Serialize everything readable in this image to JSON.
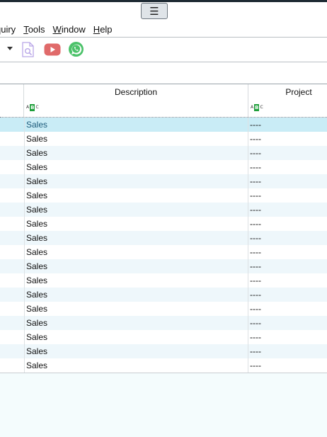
{
  "titlebar": {
    "menu_button_glyph": "☰"
  },
  "menubar": {
    "items": [
      {
        "label": "quiry"
      },
      {
        "label": "Tools",
        "accel": "T",
        "rest": "ools"
      },
      {
        "label": "Window",
        "accel": "W",
        "rest": "indow"
      },
      {
        "label": "Help",
        "accel": "H",
        "rest": "elp"
      }
    ]
  },
  "toolbar": {
    "icons": [
      "dropdown-arrow-icon",
      "document-search-icon",
      "youtube-icon",
      "whatsapp-icon"
    ],
    "colors": {
      "youtube": "#e06a6a",
      "whatsapp": "#4cc26a",
      "doc": "#b9a6e8"
    }
  },
  "grid": {
    "columns": [
      {
        "title": "Description",
        "type_badge": [
          "A",
          "B",
          "C"
        ]
      },
      {
        "title": "Project",
        "type_badge": [
          "A",
          "B",
          "C"
        ]
      }
    ],
    "rows": [
      {
        "description": "Sales",
        "project": "----"
      },
      {
        "description": "Sales",
        "project": "----"
      },
      {
        "description": "Sales",
        "project": "----"
      },
      {
        "description": "Sales",
        "project": "----"
      },
      {
        "description": "Sales",
        "project": "----"
      },
      {
        "description": "Sales",
        "project": "----"
      },
      {
        "description": "Sales",
        "project": "----"
      },
      {
        "description": "Sales",
        "project": "----"
      },
      {
        "description": "Sales",
        "project": "----"
      },
      {
        "description": "Sales",
        "project": "----"
      },
      {
        "description": "Sales",
        "project": "----"
      },
      {
        "description": "Sales",
        "project": "----"
      },
      {
        "description": "Sales",
        "project": "----"
      },
      {
        "description": "Sales",
        "project": "----"
      },
      {
        "description": "Sales",
        "project": "----"
      },
      {
        "description": "Sales",
        "project": "----"
      },
      {
        "description": "Sales",
        "project": "----"
      },
      {
        "description": "Sales",
        "project": "----"
      }
    ],
    "selected_row": 0,
    "colors": {
      "selected": "#c9ecf6",
      "alt": "#eef7fb",
      "selected_text": "#1c5a7a",
      "badge_green": "#1e9e3a"
    }
  }
}
